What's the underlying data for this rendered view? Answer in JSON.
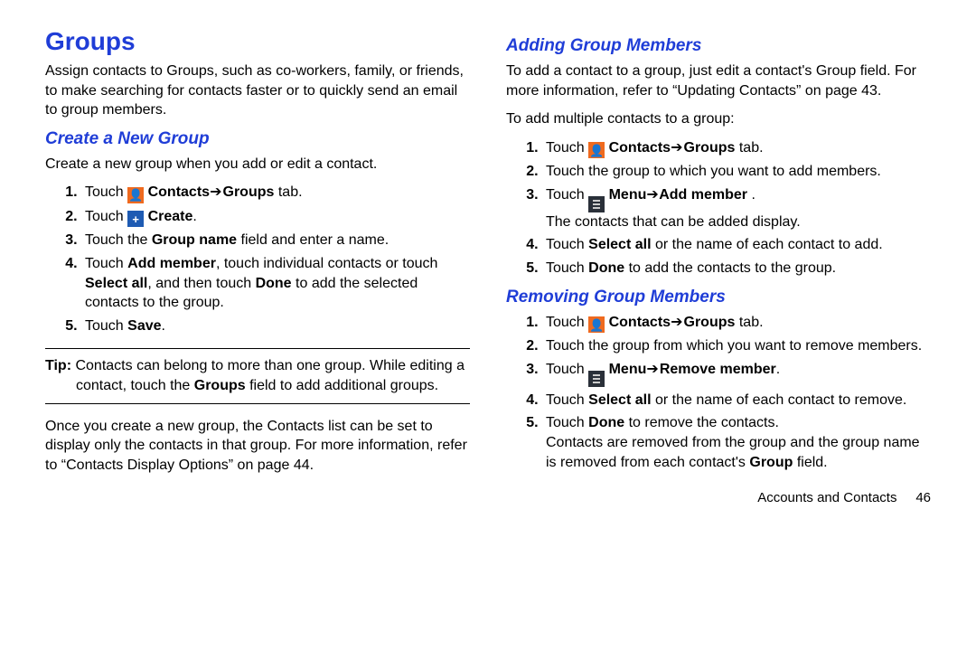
{
  "title": "Groups",
  "intro": "Assign contacts to Groups, such as co-workers, family, or friends, to make searching for contacts faster or to quickly send an email to group members.",
  "sec_create_h": "Create a New Group",
  "sec_create_intro": "Create a new group when you add or edit a contact.",
  "t_touch": "Touch",
  "contacts_bold": " Contacts",
  "arrow": " ➔ ",
  "groups_bold": " Groups ",
  "tab_txt": "tab.",
  "create_bold": " Create",
  "period": ".",
  "li_c3_a": "Touch the ",
  "group_name": "Group name",
  "li_c3_b": " field and enter a name.",
  "li_c4_a": "Touch ",
  "add_member": "Add member",
  "li_c4_b": ", touch individual contacts or touch ",
  "select_all": "Select all",
  "li_c4_c": ", and then touch ",
  "done": "Done",
  "li_c4_d": " to add the selected contacts to the group.",
  "save": "Save",
  "tip_label": "Tip:",
  "tip_body_a": " Contacts can belong to more than one group. While editing a contact, touch the ",
  "groups_lbl": "Groups",
  "tip_body_b": " field to add additional groups.",
  "after_tip_a": "Once you create a new group, the Contacts list can be set to display only the contacts in that group. For more information, refer to ",
  "after_tip_q": "“Contacts Display Options”",
  "after_tip_b": " on page 44.",
  "sec_add_h": "Adding Group Members",
  "add_intro_a": "To add a contact to a group, just edit a contact's Group field. For more information, refer to ",
  "add_intro_q": "“Updating Contacts”",
  "add_intro_b": " on page 43.",
  "add_multi": "To add multiple contacts to a group:",
  "li_a2": "Touch the group to which you want to add members.",
  "menu_bold": " Menu",
  "add_member_menu": " Add member ",
  "li_a3_after": "The contacts that can be added display.",
  "li_a4_b": " or the name of each contact to add.",
  "li_a5_b": " to add the contacts to the group.",
  "sec_rem_h": "Removing Group Members",
  "li_r2": "Touch the group from which you want to remove members.",
  "remove_member_menu": " Remove member",
  "li_r4_b": " or the name of each contact to remove.",
  "li_r5_b": " to remove the contacts.",
  "rem_after_a": "Contacts are removed from the group and the group name is removed from each contact's ",
  "group_lbl": "Group",
  "rem_after_b": " field.",
  "footer_section": "Accounts and Contacts",
  "footer_page": "46"
}
